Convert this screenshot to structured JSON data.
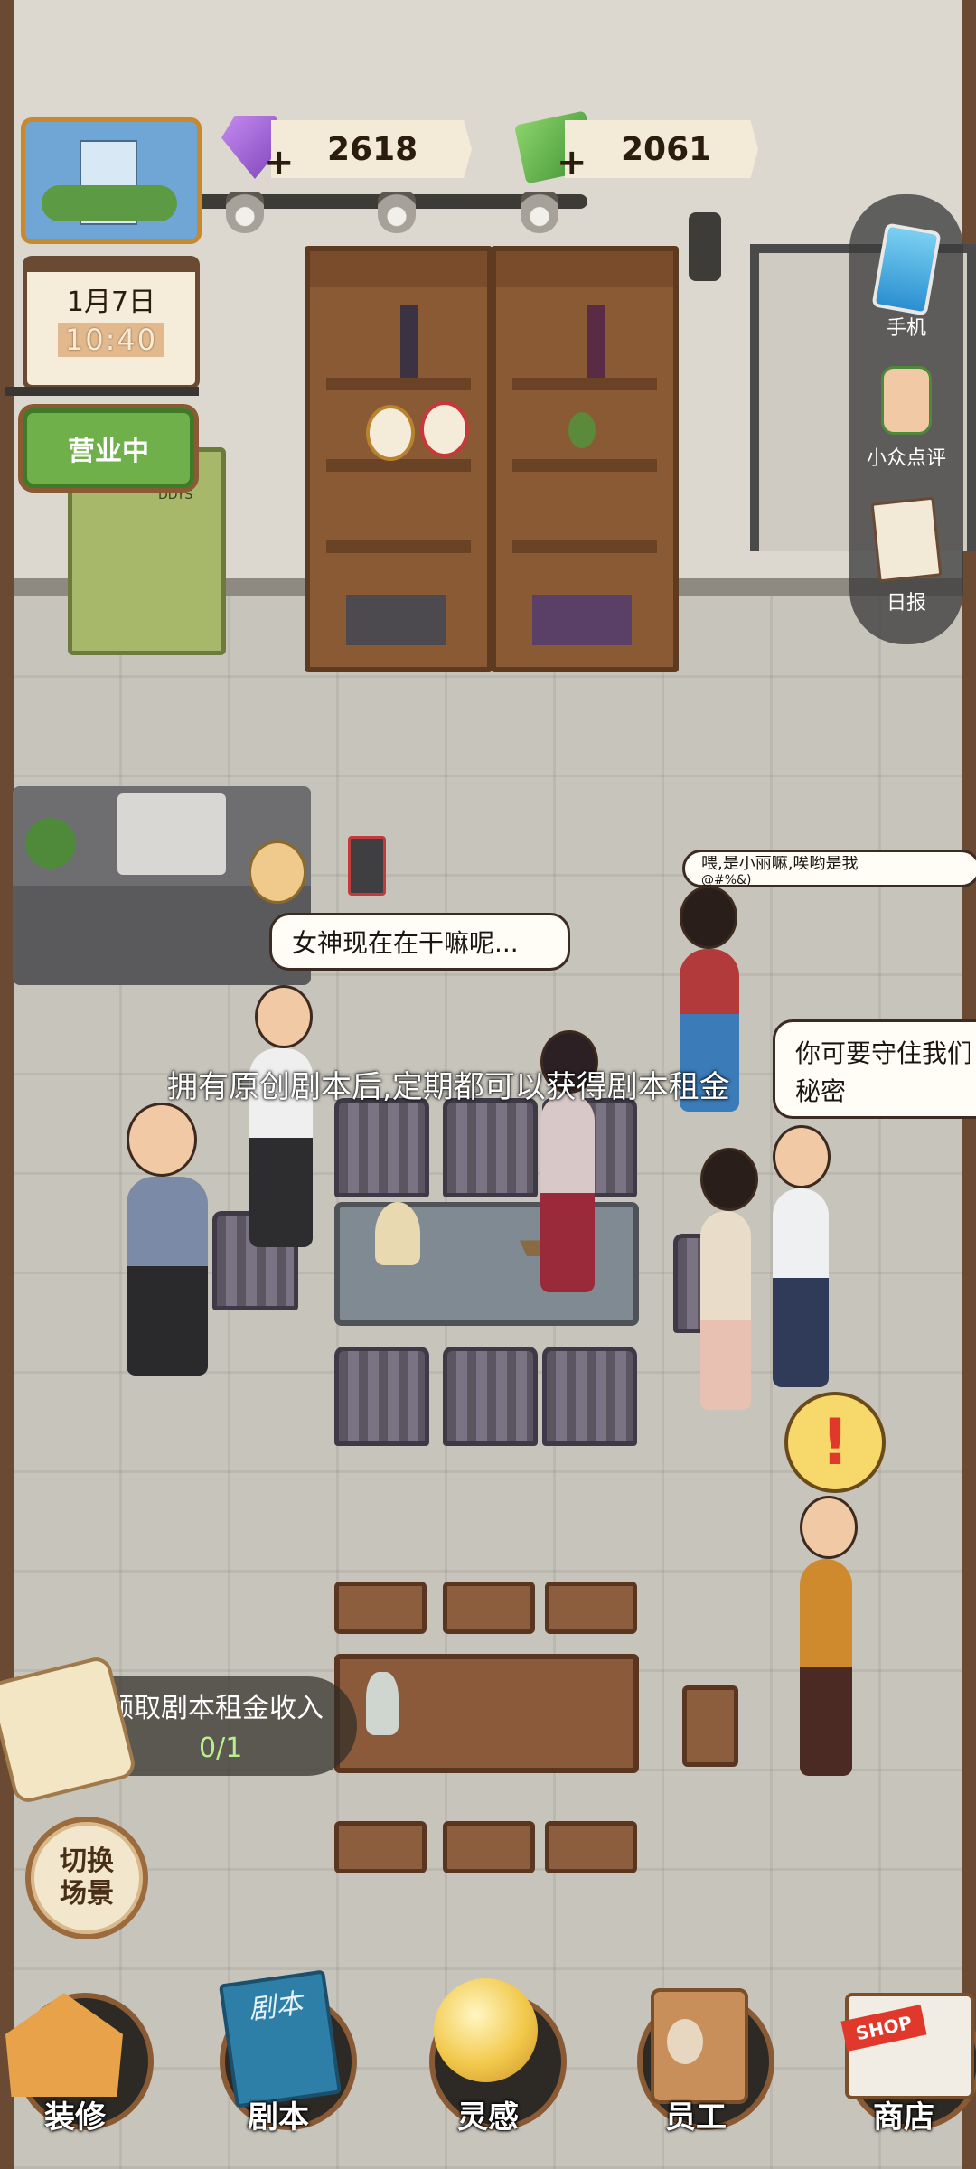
{
  "hud": {
    "gems": "2618",
    "cash": "2061",
    "date": "1月7日",
    "time": "10:40",
    "status_sign": "营业中",
    "fridge_label": "DDYS"
  },
  "side_menu": [
    {
      "label": "手机",
      "icon": "phone-icon"
    },
    {
      "label": "小众点评",
      "icon": "thumbs-up-icon"
    },
    {
      "label": "日报",
      "icon": "newspaper-icon"
    }
  ],
  "bubbles": {
    "left_npc": "女神现在在干嘛呢...",
    "top_right_npc": "喂,是小丽嘛,唉哟是我",
    "top_right_npc_line2": "@#%&)",
    "right_npc_line1": "你可要守住我们",
    "right_npc_line2": "秘密"
  },
  "scroll_message": "拥有原创剧本后,定期都可以获得剧本租金",
  "task": {
    "label": "领取剧本租金收入",
    "progress": "0/1"
  },
  "switch_scene": "切换\n场景",
  "bottom_nav": [
    {
      "label": "装修",
      "icon": "house-icon"
    },
    {
      "label": "剧本",
      "icon": "script-book-icon",
      "book_text": "剧本"
    },
    {
      "label": "灵感",
      "icon": "lightbulb-icon"
    },
    {
      "label": "员工",
      "icon": "id-badge-icon"
    },
    {
      "label": "商店",
      "icon": "shop-icon",
      "sign_text": "SHOP"
    }
  ],
  "colors": {
    "wood": "#8a5a35",
    "accent_green": "#6fb04a",
    "alert": "#e0382b"
  }
}
